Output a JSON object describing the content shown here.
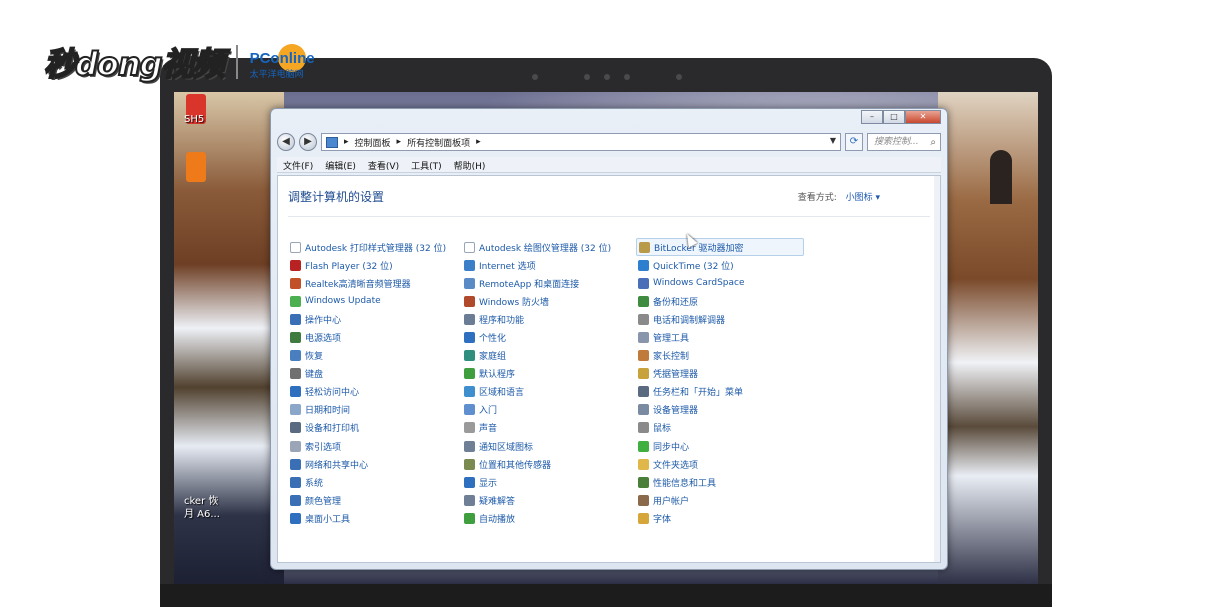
{
  "watermark": {
    "brand": "秒dong视频",
    "partner": "PConline",
    "partner_sub": "太平洋电脑网"
  },
  "desktop": {
    "left_labels": [
      "SH5",
      "cker 恢",
      "月 A6..."
    ]
  },
  "window": {
    "breadcrumb": [
      "控制面板",
      "所有控制面板项"
    ],
    "search_placeholder": "搜索控制...",
    "menu": [
      "文件(F)",
      "编辑(E)",
      "查看(V)",
      "工具(T)",
      "帮助(H)"
    ],
    "heading": "调整计算机的设置",
    "view_by_label": "查看方式:",
    "view_by_value": "小图标 ▾",
    "items": [
      {
        "label": "Autodesk 打印样式管理器 (32 位)",
        "icon": "document-icon",
        "color": "#ffffff"
      },
      {
        "label": "Autodesk 绘图仪管理器 (32 位)",
        "icon": "document-icon",
        "color": "#ffffff"
      },
      {
        "label": "BitLocker 驱动器加密",
        "icon": "bitlocker-icon",
        "color": "#b89a4a"
      },
      {
        "label": "Flash Player (32 位)",
        "icon": "flash-icon",
        "color": "#b82222"
      },
      {
        "label": "Internet 选项",
        "icon": "internet-options-icon",
        "color": "#3b7fc8"
      },
      {
        "label": "QuickTime (32 位)",
        "icon": "quicktime-icon",
        "color": "#2f7fd1"
      },
      {
        "label": "Realtek高清晰音频管理器",
        "icon": "speaker-icon",
        "color": "#c2512a"
      },
      {
        "label": "RemoteApp 和桌面连接",
        "icon": "remote-desktop-icon",
        "color": "#5a8bc7"
      },
      {
        "label": "Windows CardSpace",
        "icon": "cardspace-icon",
        "color": "#4a6fb8"
      },
      {
        "label": "Windows Update",
        "icon": "windows-update-icon",
        "color": "#4caf50"
      },
      {
        "label": "Windows 防火墙",
        "icon": "firewall-icon",
        "color": "#b04a2a"
      },
      {
        "label": "备份和还原",
        "icon": "backup-icon",
        "color": "#3f8b3f"
      },
      {
        "label": "操作中心",
        "icon": "flag-icon",
        "color": "#3a6fb5"
      },
      {
        "label": "程序和功能",
        "icon": "programs-icon",
        "color": "#6b7c95"
      },
      {
        "label": "电话和调制解调器",
        "icon": "phone-icon",
        "color": "#8a8a8a"
      },
      {
        "label": "电源选项",
        "icon": "power-icon",
        "color": "#3f7b3f"
      },
      {
        "label": "个性化",
        "icon": "personalize-icon",
        "color": "#2f6fbf"
      },
      {
        "label": "管理工具",
        "icon": "admin-tools-icon",
        "color": "#8895aa"
      },
      {
        "label": "恢复",
        "icon": "recovery-icon",
        "color": "#4a7fbf"
      },
      {
        "label": "家庭组",
        "icon": "homegroup-icon",
        "color": "#2f8f7f"
      },
      {
        "label": "家长控制",
        "icon": "parental-icon",
        "color": "#c07a3a"
      },
      {
        "label": "键盘",
        "icon": "keyboard-icon",
        "color": "#707070"
      },
      {
        "label": "默认程序",
        "icon": "default-programs-icon",
        "color": "#3f9f3f"
      },
      {
        "label": "凭据管理器",
        "icon": "credential-icon",
        "color": "#c8a23a"
      },
      {
        "label": "轻松访问中心",
        "icon": "ease-access-icon",
        "color": "#2f6fbf"
      },
      {
        "label": "区域和语言",
        "icon": "globe-icon",
        "color": "#3f8fcf"
      },
      {
        "label": "任务栏和「开始」菜单",
        "icon": "taskbar-icon",
        "color": "#5a6a80"
      },
      {
        "label": "日期和时间",
        "icon": "calendar-icon",
        "color": "#8aa6c8"
      },
      {
        "label": "入门",
        "icon": "getting-started-icon",
        "color": "#5f8fcf"
      },
      {
        "label": "设备管理器",
        "icon": "device-manager-icon",
        "color": "#7a8aa0"
      },
      {
        "label": "设备和打印机",
        "icon": "printer-icon",
        "color": "#5a6a80"
      },
      {
        "label": "声音",
        "icon": "sound-icon",
        "color": "#9a9a9a"
      },
      {
        "label": "鼠标",
        "icon": "mouse-icon",
        "color": "#8a8a8a"
      },
      {
        "label": "索引选项",
        "icon": "index-icon",
        "color": "#9aa6b8"
      },
      {
        "label": "通知区域图标",
        "icon": "notification-icon",
        "color": "#6f7f95"
      },
      {
        "label": "同步中心",
        "icon": "sync-icon",
        "color": "#3faf3f"
      },
      {
        "label": "网络和共享中心",
        "icon": "network-icon",
        "color": "#3a6fb5"
      },
      {
        "label": "位置和其他传感器",
        "icon": "sensor-icon",
        "color": "#7a8a50"
      },
      {
        "label": "文件夹选项",
        "icon": "folder-icon",
        "color": "#e0b84a"
      },
      {
        "label": "系统",
        "icon": "system-icon",
        "color": "#3a6fb5"
      },
      {
        "label": "显示",
        "icon": "display-icon",
        "color": "#2f6fbf"
      },
      {
        "label": "性能信息和工具",
        "icon": "performance-icon",
        "color": "#4a7f3a"
      },
      {
        "label": "颜色管理",
        "icon": "color-icon",
        "color": "#3a6fb5"
      },
      {
        "label": "疑难解答",
        "icon": "troubleshoot-icon",
        "color": "#6f7f95"
      },
      {
        "label": "用户帐户",
        "icon": "user-accounts-icon",
        "color": "#8a6a4a"
      },
      {
        "label": "桌面小工具",
        "icon": "gadgets-icon",
        "color": "#2f6fbf"
      },
      {
        "label": "自动播放",
        "icon": "autoplay-icon",
        "color": "#3f9f3f"
      },
      {
        "label": "字体",
        "icon": "font-icon",
        "color": "#d6a63a"
      }
    ]
  }
}
